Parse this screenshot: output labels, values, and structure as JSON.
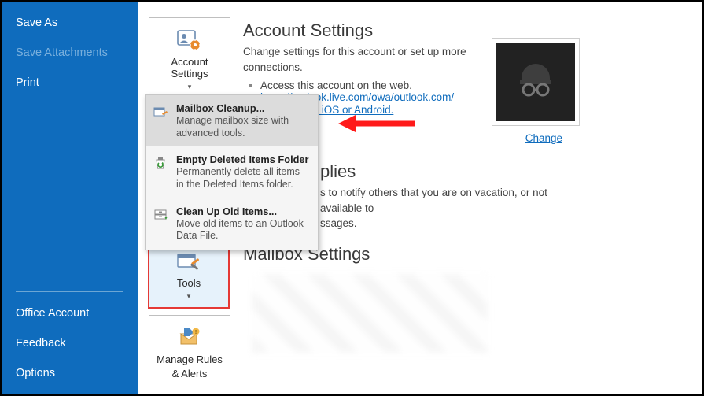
{
  "sidebar": {
    "top": [
      {
        "label": "Save As"
      },
      {
        "label": "Save Attachments"
      },
      {
        "label": "Print"
      }
    ],
    "bottom": [
      {
        "label": "Office Account"
      },
      {
        "label": "Feedback"
      },
      {
        "label": "Options"
      }
    ]
  },
  "tiles": {
    "accountSettings": {
      "label": "Account Settings"
    },
    "tools": {
      "label": "Tools"
    },
    "manageRules": {
      "label1": "Manage Rules",
      "label2": "& Alerts"
    }
  },
  "sectionAccount": {
    "title": "Account Settings",
    "desc": "Change settings for this account or set up more connections.",
    "bullet1": "Access this account on the web.",
    "link1": "https://outlook.live.com/owa/outlook.com/",
    "link2_suffix": "app for iOS or Android."
  },
  "accountPicture": {
    "changeLabel": "Change"
  },
  "sectionReplies": {
    "title_suffix": "plies",
    "desc_suffix1": "s to notify others that you are on vacation, or not available to",
    "desc_suffix2": "ssages."
  },
  "sectionMailbox": {
    "title": "Mailbox Settings"
  },
  "popup": {
    "items": [
      {
        "title": "Mailbox Cleanup...",
        "desc": "Manage mailbox size with advanced tools."
      },
      {
        "title": "Empty Deleted Items Folder",
        "desc": "Permanently delete all items in the Deleted Items folder."
      },
      {
        "title": "Clean Up Old Items...",
        "desc": "Move old items to an Outlook Data File."
      }
    ]
  }
}
